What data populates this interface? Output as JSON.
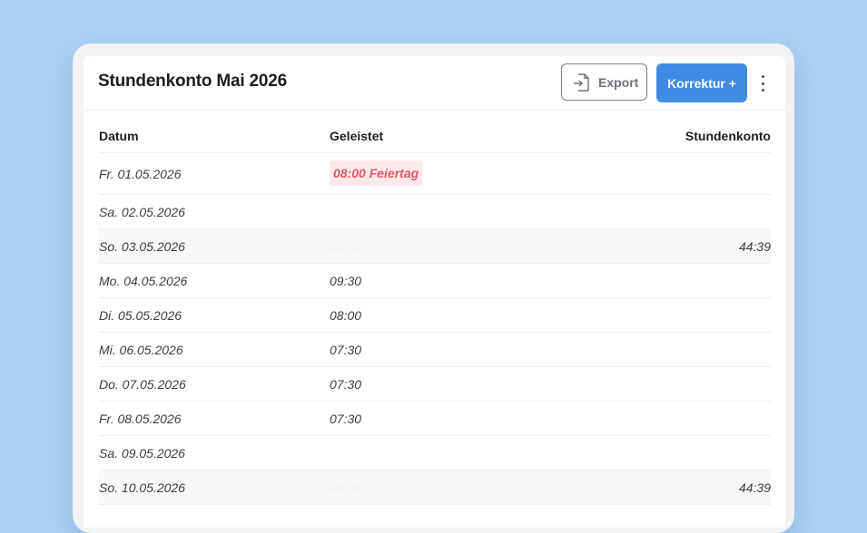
{
  "header": {
    "title": "Stundenkonto Mai 2026",
    "export_label": "Export",
    "primary_label": "Korrektur +"
  },
  "colors": {
    "background": "#aed2f6",
    "primary": "#3f8be3",
    "holiday_text": "#e05a66",
    "holiday_bg": "#fde9ea"
  },
  "table": {
    "columns": [
      "Datum",
      "Geleistet",
      "Stundenkonto"
    ],
    "rows": [
      {
        "date": "Fr. 01.05.2026",
        "worked": "08:00 Feiertag",
        "balance": ""
      },
      {
        "date": "Sa. 02.05.2026",
        "worked": "",
        "balance": ""
      },
      {
        "date": "So. 03.05.2026",
        "worked": "00:00",
        "balance": "44:39"
      },
      {
        "date": "Mo. 04.05.2026",
        "worked": "09:30",
        "balance": ""
      },
      {
        "date": "Di. 05.05.2026",
        "worked": "08:00",
        "balance": ""
      },
      {
        "date": "Mi. 06.05.2026",
        "worked": "07:30",
        "balance": ""
      },
      {
        "date": "Do. 07.05.2026",
        "worked": "07:30",
        "balance": ""
      },
      {
        "date": "Fr. 08.05.2026",
        "worked": "07:30",
        "balance": ""
      },
      {
        "date": "Sa. 09.05.2026",
        "worked": "",
        "balance": ""
      },
      {
        "date": "So. 10.05.2026",
        "worked": "00:00",
        "balance": "44:39"
      }
    ]
  }
}
